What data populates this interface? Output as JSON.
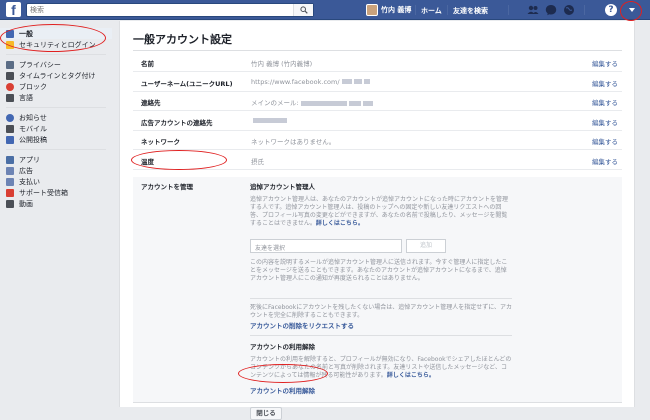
{
  "header": {
    "logo": "f",
    "search_placeholder": "検索",
    "user_name": "竹内 義博",
    "home": "ホーム",
    "find_friends": "友達を検索",
    "help": "?"
  },
  "sidebar": {
    "groups": [
      [
        {
          "label": "一般",
          "icon": "gear-icon",
          "active": true
        },
        {
          "label": "セキュリティとログイン",
          "icon": "shield-icon"
        }
      ],
      [
        {
          "label": "プライバシー",
          "icon": "lock-icon"
        },
        {
          "label": "タイムラインとタグ付け",
          "icon": "timeline-icon"
        },
        {
          "label": "ブロック",
          "icon": "block-icon"
        },
        {
          "label": "言語",
          "icon": "language-icon"
        }
      ],
      [
        {
          "label": "お知らせ",
          "icon": "globe-icon"
        },
        {
          "label": "モバイル",
          "icon": "mobile-icon"
        },
        {
          "label": "公開投稿",
          "icon": "rss-icon"
        }
      ],
      [
        {
          "label": "アプリ",
          "icon": "apps-icon"
        },
        {
          "label": "広告",
          "icon": "ads-icon"
        },
        {
          "label": "支払い",
          "icon": "payment-icon"
        },
        {
          "label": "サポート受信箱",
          "icon": "support-icon"
        },
        {
          "label": "動画",
          "icon": "video-icon"
        }
      ]
    ]
  },
  "main": {
    "title": "一般アカウント設定",
    "edit_label": "編集する",
    "rows": [
      {
        "label": "名前",
        "value": "竹内 義博 (竹内義博)"
      },
      {
        "label": "ユーザーネーム(ユニークURL)",
        "value": "https://www.facebook.com/"
      },
      {
        "label": "連絡先",
        "value": "メインのメール:"
      },
      {
        "label": "広告アカウントの連絡先",
        "value": ""
      },
      {
        "label": "ネットワーク",
        "value": "ネットワークはありません。"
      },
      {
        "label": "温度",
        "value": "摂氏"
      }
    ],
    "manage": {
      "label": "アカウントを管理",
      "legacy_title": "追悼アカウント管理人",
      "legacy_text": "追悼アカウント管理人は、あなたのアカウントが追悼アカウントになった時にアカウントを管理する人です。追悼アカウント管理人は、投稿のトップへの固定や新しい友達リクエストへの回答、プロフィール写真の変更などができますが、あなたの名前で投稿したり、メッセージを閲覧することはできません。",
      "legacy_more": "詳しくはこちら。",
      "friend_placeholder": "友達を選択",
      "add_button": "追加",
      "notify_text": "この内容を説明するメールが追悼アカウント管理人に送信されます。今すぐ管理人に指定したことをメッセージを送ることもできます。あなたのアカウントが追悼アカウントになるまで、追悼アカウント管理人にこの通知が再度送られることはありません。",
      "delete_text": "死後にFacebookにアカウントを残したくない場合は、追悼アカウント管理人を指定せずに、アカウントを完全に削除することもできます。",
      "delete_link": "アカウントの削除をリクエストする",
      "deactivate_title": "アカウントの利用解除",
      "deactivate_text": "アカウントの利用を解除すると、プロフィールが無効になり、Facebookでシェアしたほとんどのコンテンツからあなたの名前と写真が削除されます。友達リストや送信したメッセージなど、コンテンツによっては情報が残る可能性があります。",
      "deactivate_more": "詳しくはこちら。",
      "deactivate_link": "アカウントの利用解除",
      "close_button": "閉じる"
    }
  },
  "colors": {
    "brand": "#3b5998",
    "link": "#365899",
    "annotation": "#e02020"
  }
}
